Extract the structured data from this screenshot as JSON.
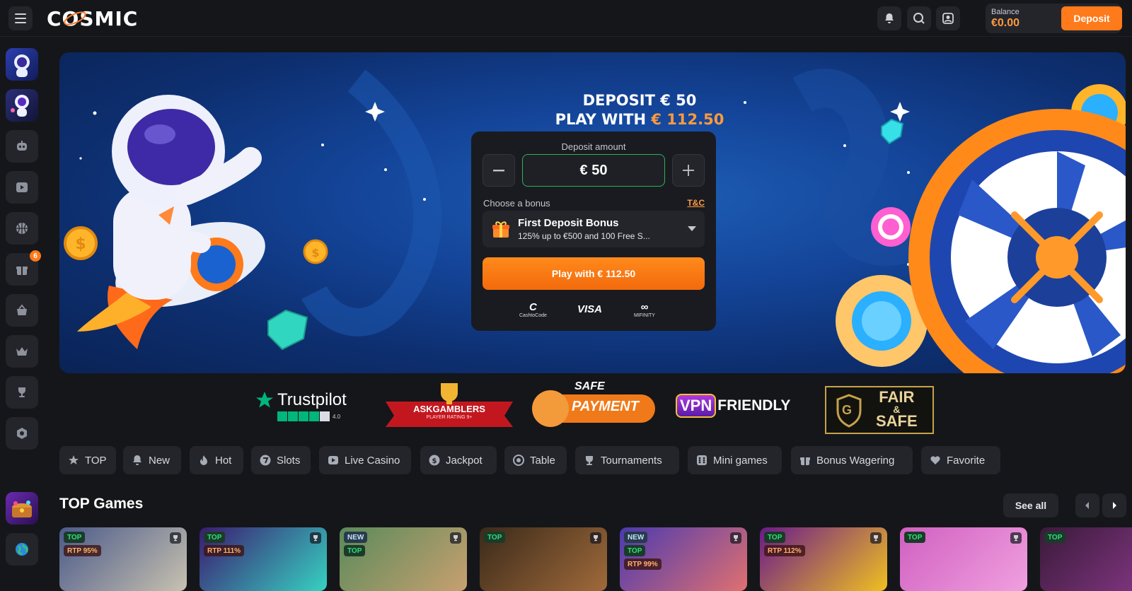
{
  "header": {
    "logo": "COSMIC",
    "balance_label": "Balance",
    "balance_value": "€0.00",
    "deposit_label": "Deposit"
  },
  "sidebar": {
    "bonus_badge": "6",
    "items": [
      "astronaut-promo",
      "astronaut-avatar",
      "games-robot",
      "live",
      "sport",
      "bonuses",
      "shop",
      "vip",
      "tournaments",
      "support",
      "treasure-promo",
      "language"
    ]
  },
  "hero": {
    "title_line1": "DEPOSIT € 50",
    "title_line2_prefix": "PLAY WITH ",
    "title_line2_accent": "€ 112.50",
    "deposit_amount_label": "Deposit amount",
    "amount_value": "€ 50",
    "choose_bonus_label": "Choose a bonus",
    "tnc_label": "T&C",
    "bonus_title": "First Deposit Bonus",
    "bonus_subtitle": "125% up to €500 and 100 Free S...",
    "play_button": "Play with € 112.50",
    "payments": [
      {
        "name": "C",
        "sub": "CashtoCode"
      },
      {
        "name": "VISA",
        "sub": ""
      },
      {
        "name": "∞",
        "sub": "MIFINITY"
      }
    ]
  },
  "trust": {
    "trustpilot": "Trustpilot",
    "trustpilot_score": "4.0",
    "askgamblers": "ASKGAMBLERS",
    "askgamblers_sub": "PLAYER RATING 9+",
    "safe_line1": "SAFE",
    "safe_line2": "PAYMENT",
    "vpn_a": "VPN",
    "vpn_b": "FRIENDLY",
    "fair_line1": "FAIR",
    "fair_line2": "&",
    "fair_line3": "SAFE",
    "fair_letter": "G"
  },
  "categories": [
    "TOP",
    "New",
    "Hot",
    "Slots",
    "Live Casino",
    "Jackpot",
    "Table",
    "Tournaments",
    "Mini games",
    "Bonus Wagering",
    "Favorite"
  ],
  "games_section": {
    "title": "TOP Games",
    "see_all": "See all",
    "cards": [
      {
        "tags": [
          "TOP",
          "RTP 95%"
        ],
        "colors": [
          "#4b5a8a",
          "#c8c2b0"
        ]
      },
      {
        "tags": [
          "TOP",
          "RTP 111%"
        ],
        "colors": [
          "#3b1a70",
          "#36d2c2"
        ]
      },
      {
        "tags": [
          "NEW",
          "TOP"
        ],
        "colors": [
          "#5a8a5a",
          "#c8a070"
        ]
      },
      {
        "tags": [
          "TOP"
        ],
        "colors": [
          "#3a2a1a",
          "#a06a3a"
        ]
      },
      {
        "tags": [
          "NEW",
          "TOP",
          "RTP 99%"
        ],
        "colors": [
          "#4a3ab0",
          "#e07070"
        ]
      },
      {
        "tags": [
          "TOP",
          "RTP 112%"
        ],
        "colors": [
          "#6a1a8a",
          "#f0c020"
        ]
      },
      {
        "tags": [
          "TOP"
        ],
        "colors": [
          "#d060c0",
          "#f0a0e0"
        ]
      },
      {
        "tags": [
          "TOP"
        ],
        "colors": [
          "#3a1a3a",
          "#8a3a8a"
        ]
      }
    ]
  },
  "colors": {
    "accent": "#ff7a1a",
    "accent_text": "#ff9a3c",
    "panel": "#23252b",
    "background": "#15161a",
    "success": "#26b45c"
  }
}
